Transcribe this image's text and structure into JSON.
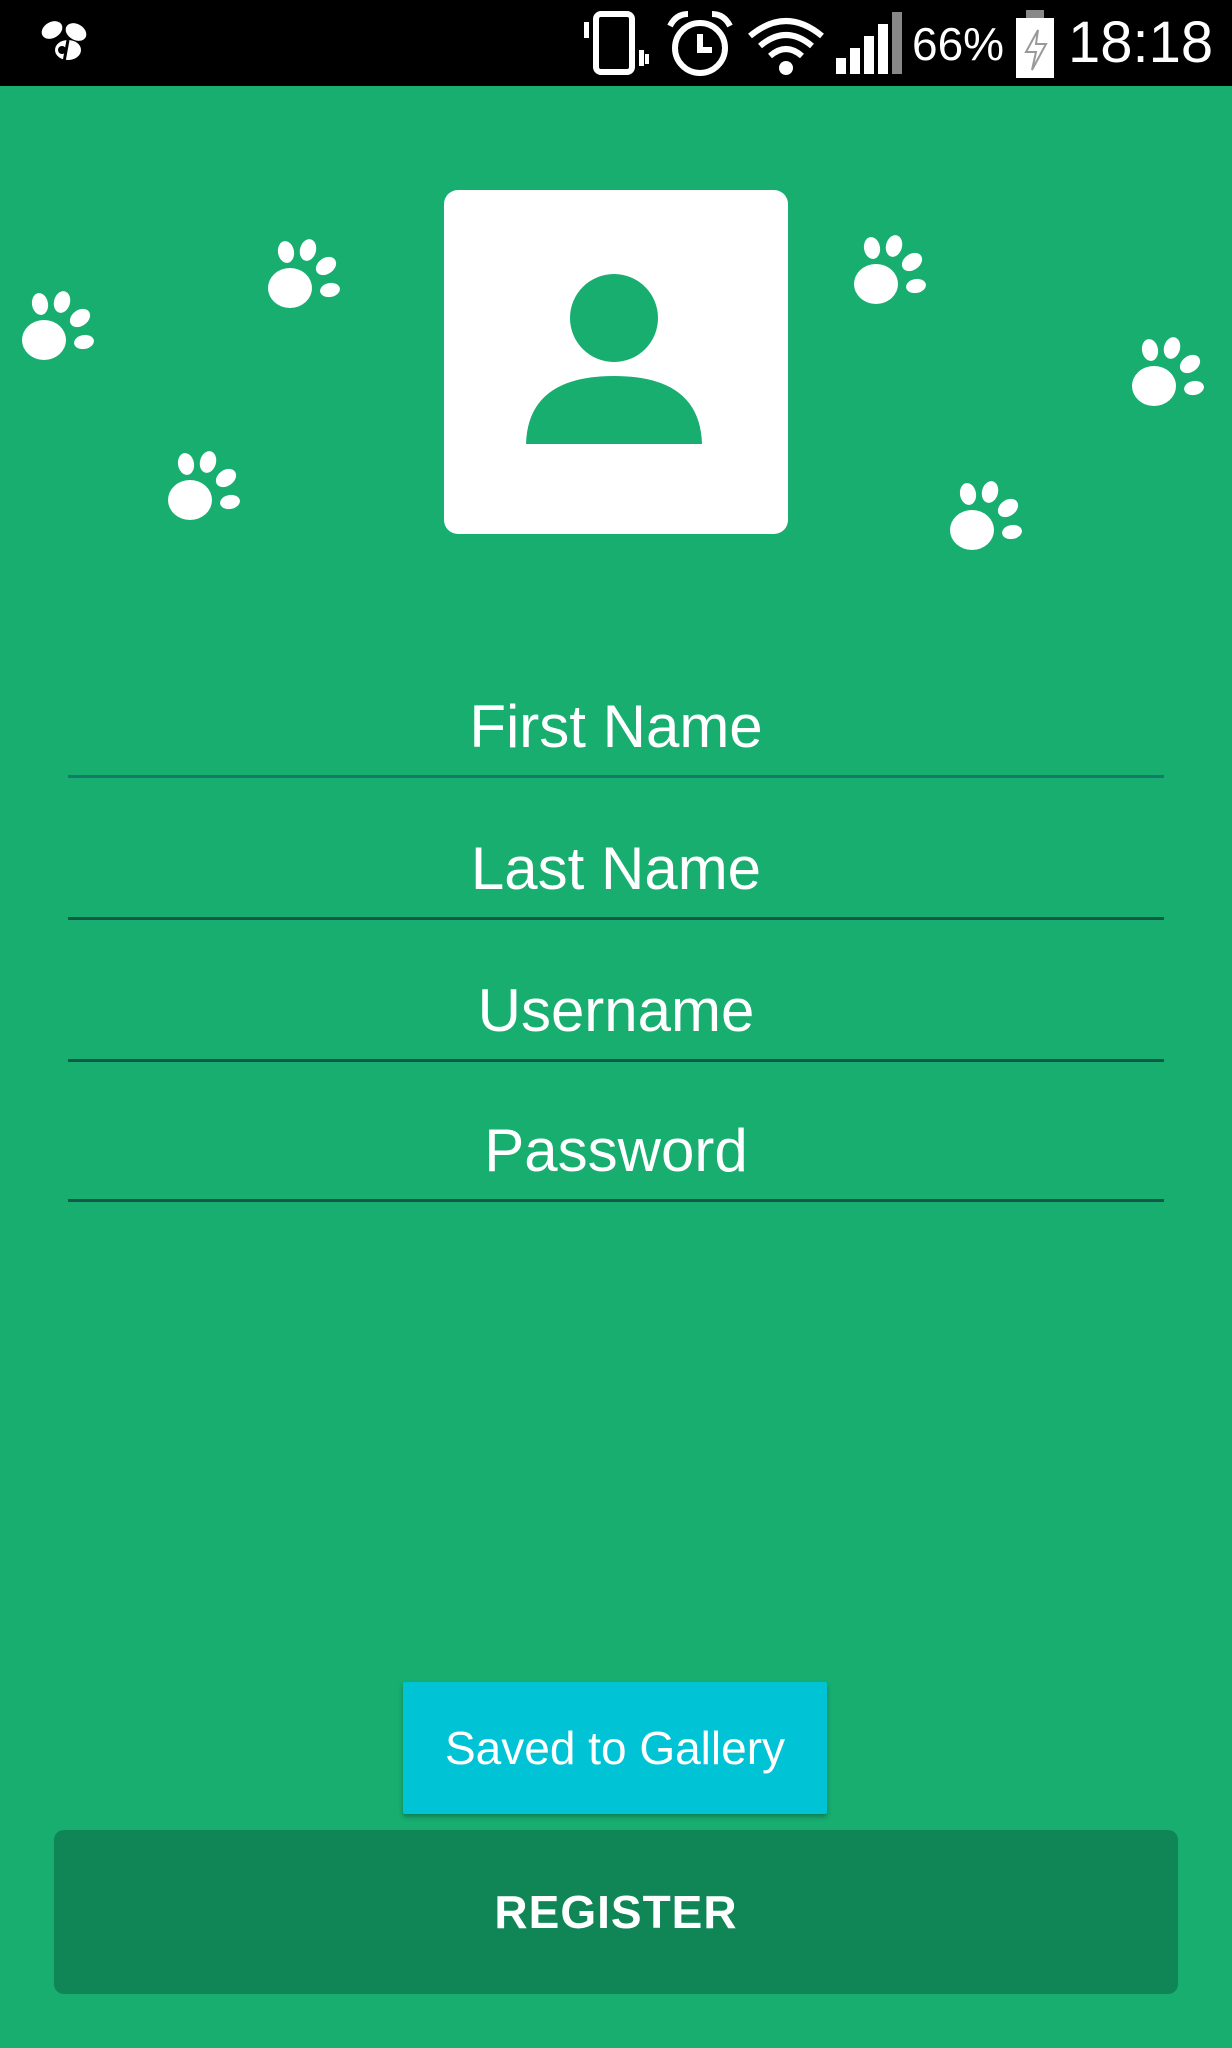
{
  "status_bar": {
    "battery_percent": "66%",
    "time": "18:18",
    "icons": [
      "notification-app-icon",
      "vibrate-icon",
      "alarm-icon",
      "wifi-icon",
      "signal-icon",
      "battery-charging-icon"
    ]
  },
  "colors": {
    "background": "#17ae70",
    "status_bar": "#000000",
    "field_underline": "#17574a",
    "gallery_button": "#00c3d5",
    "register_button": "#108556",
    "avatar_silhouette": "#17ae70"
  },
  "decorations": {
    "paw_icon": "paw-print-icon"
  },
  "avatar": {
    "icon": "person-icon"
  },
  "form": {
    "first_name_placeholder": "First Name",
    "last_name_placeholder": "Last Name",
    "username_placeholder": "Username",
    "password_placeholder": "Password"
  },
  "buttons": {
    "gallery_label": "Saved to Gallery",
    "register_label": "REGISTER"
  }
}
